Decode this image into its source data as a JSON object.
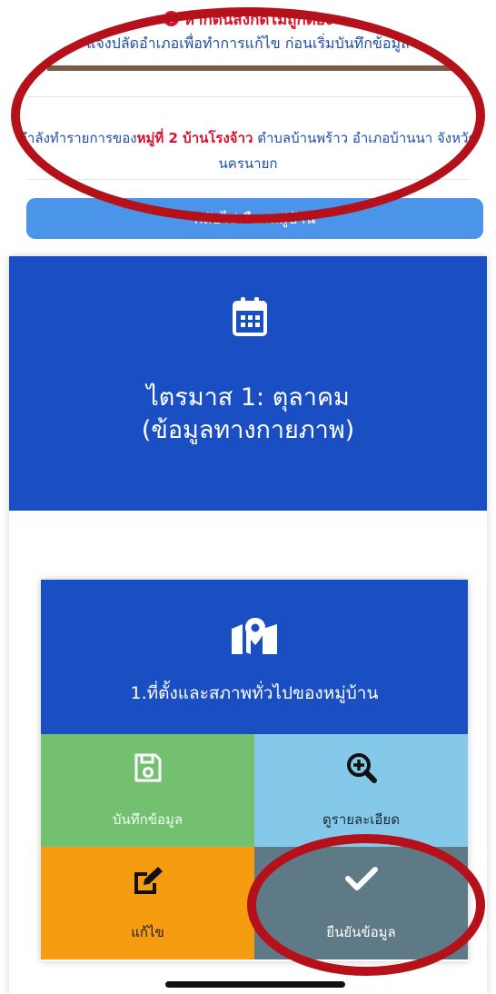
{
  "warning": {
    "text": "หากต้นสังกัดไม่ถูกต้อง",
    "icon": "alert-circle-icon",
    "color": "#d9112a"
  },
  "instruction": {
    "text": "แจ้งปลัดอำเภอเพื่อทำการแก้ไข ก่อนเริ่มบันทึกข้อมูล"
  },
  "context": {
    "prefix": "กำลังทำรายการของ",
    "village": "หมู่ที่ 2 บ้านโรงจ้าว",
    "suffix": " ตำบลบ้านพร้าว อำเภอบ้านนา จังหวัดนครนายก"
  },
  "change_village_button": {
    "label": "กลับไปเลือกหมู่บ้าน",
    "color": "#4a94e9"
  },
  "quarter": {
    "icon": "calendar-icon",
    "line1": "ไตรมาส 1: ตุลาคม",
    "line2": "(ข้อมูลทางกายภาพ)",
    "color": "#1a4fc4"
  },
  "topic": {
    "icon": "map-marker-icon",
    "title": "1.ที่ตั้งและสภาพทั่วไปของหมู่บ้าน"
  },
  "actions": [
    {
      "label": "บันทึกข้อมูล",
      "icon": "save-icon",
      "color": "#72c070"
    },
    {
      "label": "ดูรายละเอียด",
      "icon": "zoom-in-icon",
      "color": "#85c9ea"
    },
    {
      "label": "แก้ไข",
      "icon": "edit-icon",
      "color": "#f59c10"
    },
    {
      "label": "ยืนยันข้อมูล",
      "icon": "check-icon",
      "color": "#5d7a86"
    }
  ]
}
